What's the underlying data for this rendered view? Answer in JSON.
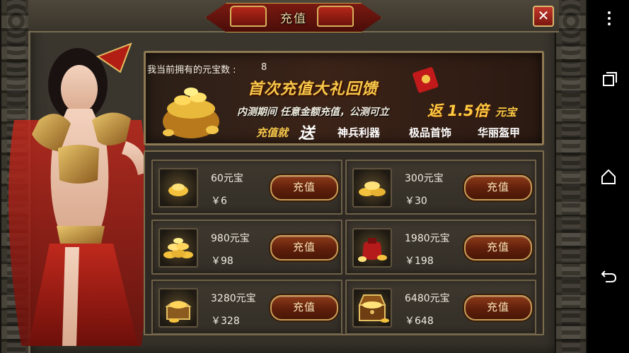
{
  "window": {
    "title": "充值",
    "close_label": "✕"
  },
  "banner": {
    "caption": "我当前拥有的元宝数 :",
    "caption_value": "8",
    "title": "首次充值大礼回馈",
    "subtitle": "内测期间 任意金额充值，公测可立",
    "bonus": "返 1.5倍",
    "unit": "元宝",
    "line3_prefix": "充值就",
    "line3_send": "送",
    "rewards": [
      "神兵利器",
      "极品首饰",
      "华丽盔甲"
    ]
  },
  "packages": [
    {
      "name": "60元宝",
      "price": "￥6",
      "button": "充值",
      "icon": "gold-ingot-small-icon"
    },
    {
      "name": "300元宝",
      "price": "￥30",
      "button": "充值",
      "icon": "gold-ingot-pile-icon"
    },
    {
      "name": "980元宝",
      "price": "￥98",
      "button": "充值",
      "icon": "gold-ingot-heap-icon"
    },
    {
      "name": "1980元宝",
      "price": "￥198",
      "button": "充值",
      "icon": "gold-pouch-icon"
    },
    {
      "name": "3280元宝",
      "price": "￥328",
      "button": "充值",
      "icon": "gold-chest-icon"
    },
    {
      "name": "6480元宝",
      "price": "￥648",
      "button": "充值",
      "icon": "treasure-chest-icon"
    }
  ],
  "colors": {
    "gold_text": "#f7c84a",
    "button_bg": "#5f1f0b",
    "frame": "#7e6e4c"
  }
}
